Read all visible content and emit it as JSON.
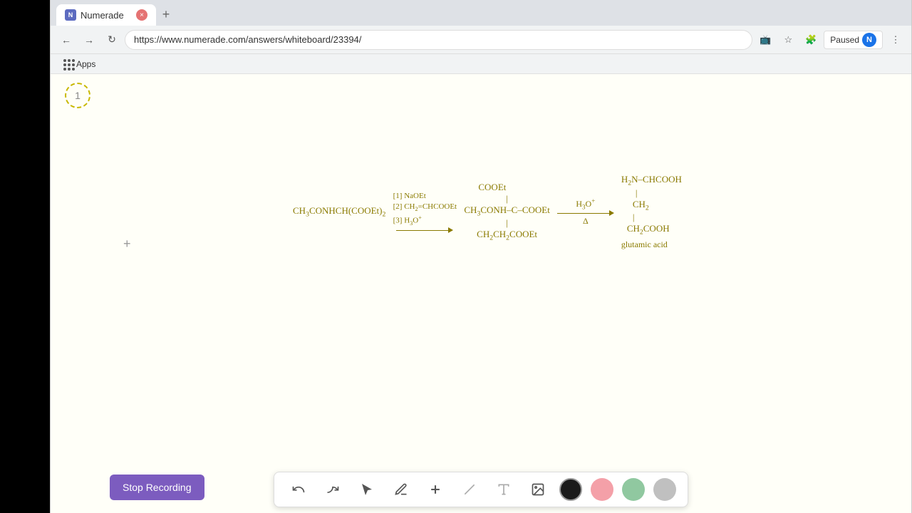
{
  "browser": {
    "tab_label": "Numerade",
    "url": "https://www.numerade.com/answers/whiteboard/23394/",
    "new_tab_label": "+",
    "paused_label": "Paused",
    "avatar_letter": "N",
    "apps_label": "Apps"
  },
  "page": {
    "page_number": "1",
    "canvas_plus": "+"
  },
  "toolbar": {
    "stop_recording_label": "Stop Recording"
  },
  "reaction": {
    "reactant": "CH₃CONHCH(COOEt)₂",
    "reagents": [
      "[1] NaOEt",
      "[2] CH₂=CHCOOEt",
      "[3] H₃O⁺"
    ],
    "intermediate": "CH₃CONH–C–COOEt",
    "sub_groups": [
      "COOEt",
      "CH₂CH₂COOEt"
    ],
    "h3o_label": "H₃O⁺",
    "delta_label": "Δ",
    "product_name": "glutamic acid",
    "product_lines": [
      "H₂N–CHCOOH",
      "CH₂",
      "CH₂COOH"
    ]
  }
}
